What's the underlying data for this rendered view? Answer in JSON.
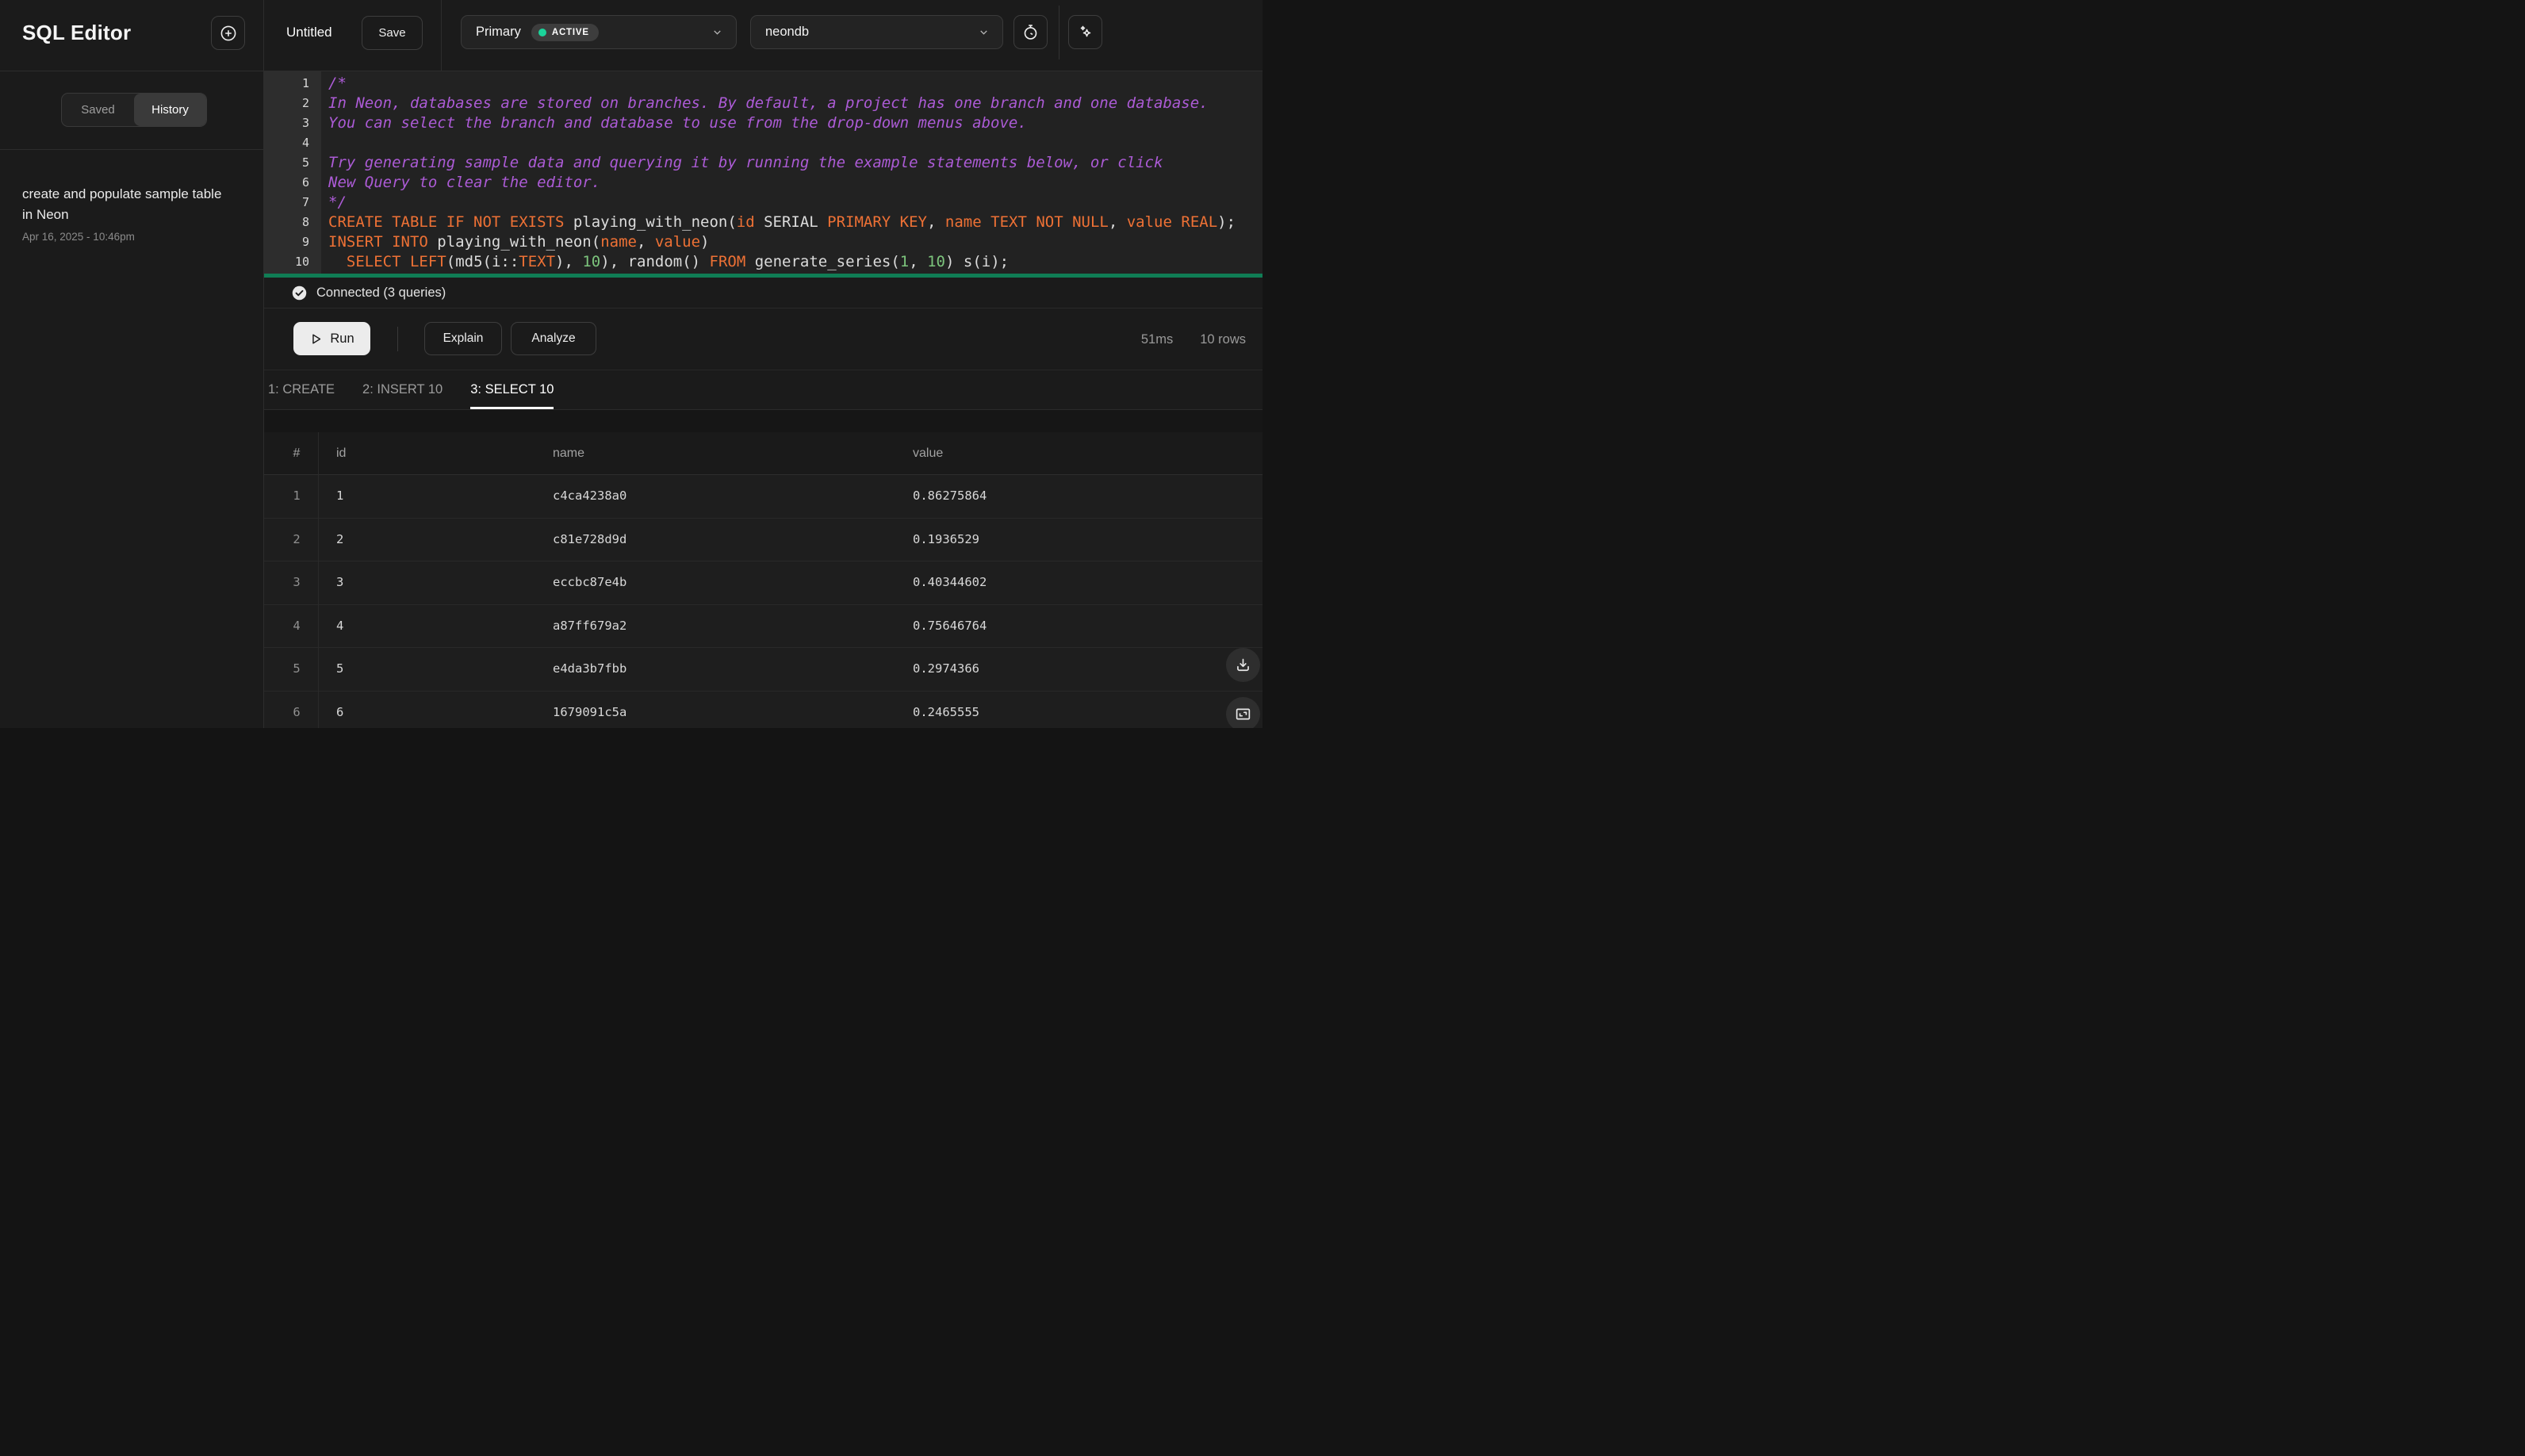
{
  "sidebar": {
    "title": "SQL Editor",
    "tabs": [
      {
        "label": "Saved",
        "active": false
      },
      {
        "label": "History",
        "active": true
      }
    ],
    "history": [
      {
        "title": "create and populate sample table in Neon",
        "timestamp": "Apr 16, 2025 - 10:46pm"
      }
    ]
  },
  "topbar": {
    "document_title": "Untitled",
    "save_label": "Save",
    "branch": {
      "value": "Primary",
      "status_badge": "ACTIVE",
      "status_color": "#1bd39a"
    },
    "database": {
      "value": "neondb"
    },
    "icon_buttons": [
      "stopwatch-icon",
      "sparkles-icon"
    ]
  },
  "editor": {
    "syntax_colors": {
      "comment": "#ac5bd6",
      "keyword": "#ee7135",
      "number": "#7cc47c",
      "plain": "#dcdcdc",
      "highlight_bar": "#107d55"
    },
    "lines": [
      {
        "n": "1",
        "tokens": [
          [
            "c",
            "/*"
          ]
        ]
      },
      {
        "n": "2",
        "tokens": [
          [
            "c",
            "In Neon, databases are stored on branches. By default, a project has one branch and one database."
          ]
        ]
      },
      {
        "n": "3",
        "tokens": [
          [
            "c",
            "You can select the branch and database to use from the drop-down menus above."
          ]
        ]
      },
      {
        "n": "4",
        "tokens": []
      },
      {
        "n": "5",
        "tokens": [
          [
            "c",
            "Try generating sample data and querying it by running the example statements below, or click"
          ]
        ]
      },
      {
        "n": "6",
        "tokens": [
          [
            "c",
            "New Query to clear the editor."
          ]
        ]
      },
      {
        "n": "7",
        "tokens": [
          [
            "c",
            "*/"
          ]
        ]
      },
      {
        "n": "8",
        "tokens": [
          [
            "k",
            "CREATE TABLE IF NOT EXISTS"
          ],
          [
            "p",
            " playing_with_neon("
          ],
          [
            "k",
            "id"
          ],
          [
            "p",
            " SERIAL "
          ],
          [
            "k",
            "PRIMARY KEY"
          ],
          [
            "p",
            ", "
          ],
          [
            "k",
            "name"
          ],
          [
            "p",
            " "
          ],
          [
            "k",
            "TEXT NOT NULL"
          ],
          [
            "p",
            ", "
          ],
          [
            "k",
            "value"
          ],
          [
            "p",
            " "
          ],
          [
            "k",
            "REAL"
          ],
          [
            "p",
            ");"
          ]
        ]
      },
      {
        "n": "9",
        "tokens": [
          [
            "k",
            "INSERT INTO"
          ],
          [
            "p",
            " playing_with_neon("
          ],
          [
            "k",
            "name"
          ],
          [
            "p",
            ", "
          ],
          [
            "k",
            "value"
          ],
          [
            "p",
            ")"
          ]
        ]
      },
      {
        "n": "10",
        "tokens": [
          [
            "p",
            "  "
          ],
          [
            "k",
            "SELECT"
          ],
          [
            "p",
            " "
          ],
          [
            "k",
            "LEFT"
          ],
          [
            "p",
            "(md5(i::"
          ],
          [
            "k",
            "TEXT"
          ],
          [
            "p",
            "), "
          ],
          [
            "n",
            "10"
          ],
          [
            "p",
            "), random() "
          ],
          [
            "k",
            "FROM"
          ],
          [
            "p",
            " generate_series("
          ],
          [
            "n",
            "1"
          ],
          [
            "p",
            ", "
          ],
          [
            "n",
            "10"
          ],
          [
            "p",
            ") s(i);"
          ]
        ]
      }
    ]
  },
  "status_bar": {
    "label": "Connected (3 queries)"
  },
  "actions": {
    "run": "Run",
    "explain": "Explain",
    "analyze": "Analyze",
    "duration": "51ms",
    "row_count": "10 rows"
  },
  "result_tabs": [
    {
      "label": "1: CREATE",
      "active": false
    },
    {
      "label": "2: INSERT 10",
      "active": false
    },
    {
      "label": "3: SELECT 10",
      "active": true
    }
  ],
  "results_table": {
    "columns": [
      "#",
      "id",
      "name",
      "value"
    ],
    "rows": [
      {
        "index": "1",
        "id": "1",
        "name": "c4ca4238a0",
        "value": "0.86275864"
      },
      {
        "index": "2",
        "id": "2",
        "name": "c81e728d9d",
        "value": "0.1936529"
      },
      {
        "index": "3",
        "id": "3",
        "name": "eccbc87e4b",
        "value": "0.40344602"
      },
      {
        "index": "4",
        "id": "4",
        "name": "a87ff679a2",
        "value": "0.75646764"
      },
      {
        "index": "5",
        "id": "5",
        "name": "e4da3b7fbb",
        "value": "0.2974366"
      },
      {
        "index": "6",
        "id": "6",
        "name": "1679091c5a",
        "value": "0.2465555"
      }
    ]
  },
  "floating_actions": [
    "download-icon",
    "expand-icon"
  ]
}
